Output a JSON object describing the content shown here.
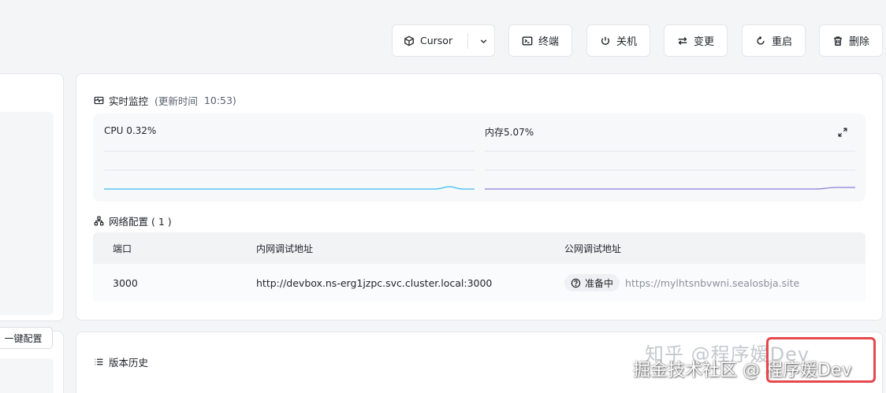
{
  "toolbar": {
    "ide_label": "Cursor",
    "terminal_label": "终端",
    "shutdown_label": "关机",
    "change_label": "变更",
    "restart_label": "重启",
    "delete_label": "删除"
  },
  "left": {
    "oneclick_label": "一键配置"
  },
  "monitor": {
    "title": "实时监控",
    "update_prefix": "(更新时间",
    "update_time": "10:53)",
    "cpu_label": "CPU 0.32%",
    "mem_label": "内存5.07%",
    "cpu_color": "#38bdf8",
    "mem_color": "#8b7fd6"
  },
  "network": {
    "title": "网络配置 ( 1 )",
    "columns": [
      "端口",
      "内网调试地址",
      "公网调试地址"
    ],
    "rows": [
      {
        "port": "3000",
        "internal": "http://devbox.ns-erg1jzpc.svc.cluster.local:3000",
        "status": "准备中",
        "public": "https://mylhtsnbvwni.sealosbja.site"
      }
    ]
  },
  "history": {
    "title": "版本历史"
  },
  "watermark": {
    "line1": "知乎 @程序媛Dev",
    "line2": "掘金技术社区 @ 程序媛Dev"
  },
  "colors": {
    "highlight": "#e5484d"
  }
}
